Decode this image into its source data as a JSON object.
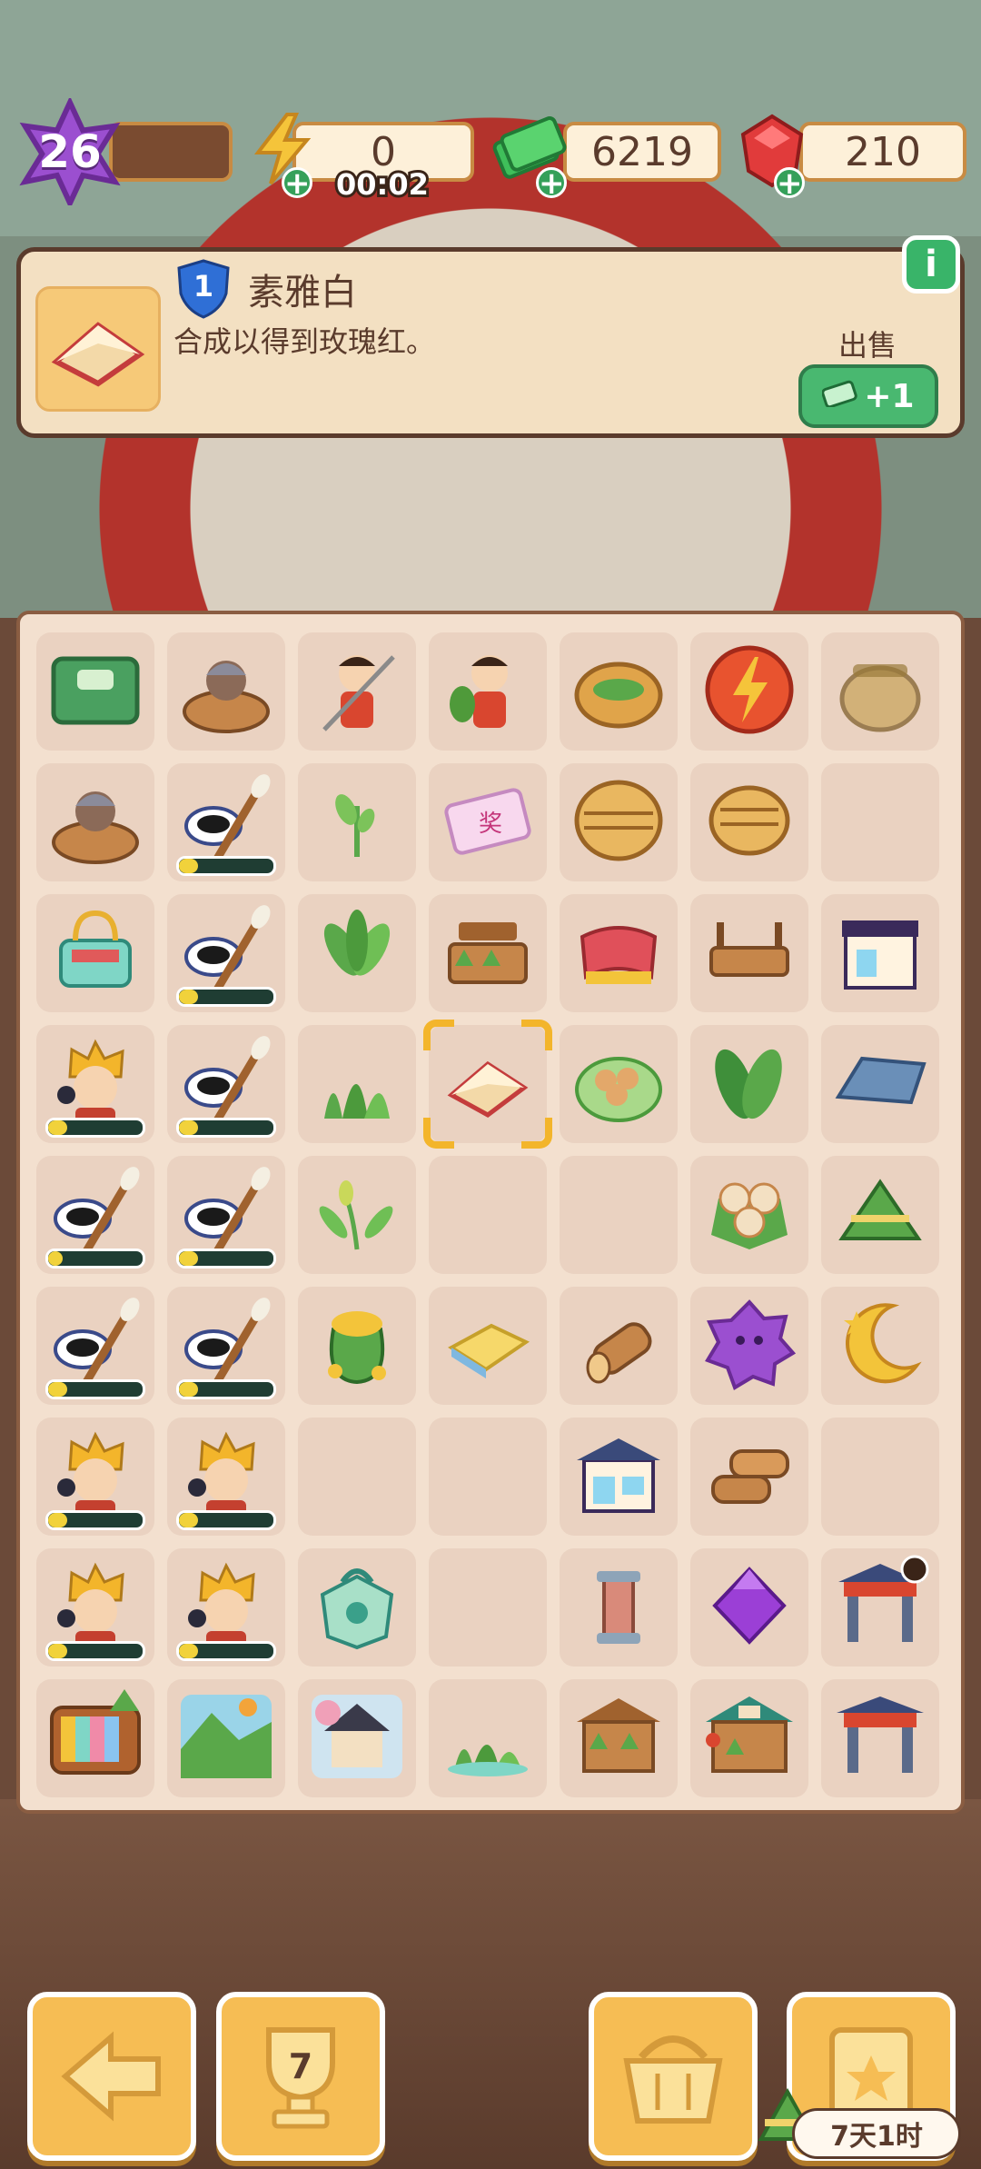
{
  "top_bar": {
    "level": "26",
    "energy": "0",
    "energy_timer": "00:02",
    "cash": "6219",
    "gems": "210"
  },
  "info_panel": {
    "tier": "1",
    "title": "素雅白",
    "description": "合成以得到玫瑰红。",
    "sell_label": "出售",
    "sell_value": "+1",
    "info_icon": "i"
  },
  "board": {
    "columns": 7,
    "rows": 9,
    "selected_cell": {
      "row": 3,
      "col": 3
    },
    "cells": [
      [
        "crate-icon",
        "bath-old-icon",
        "warrior-icon",
        "farmer-icon",
        "leaf-basket-icon",
        "energy-orb-icon",
        "pot-icon"
      ],
      [
        "bath-old-icon",
        "ink-brush-icon",
        "sprout-icon",
        "ticket-icon",
        "steamer-icon",
        "steamer-lid-icon",
        "empty"
      ],
      [
        "gift-basket-icon",
        "ink-brush-icon",
        "plant-icon",
        "zongzi-stall-icon",
        "cloth-icon",
        "table-icon",
        "shop-icon"
      ],
      [
        "chef-icon",
        "ink-brush-icon",
        "grass-icon",
        "tofu-icon",
        "dumpling-plate-icon",
        "big-leaves-icon",
        "roof-icon"
      ],
      [
        "ink-brush-icon",
        "ink-brush-icon",
        "rice-plant-icon",
        "empty",
        "empty",
        "dumpling-pile-icon",
        "zongzi-icon"
      ],
      [
        "ink-brush-icon",
        "ink-brush-icon",
        "money-bag-icon",
        "butter-icon",
        "log-icon",
        "purple-gem-icon",
        "moon-icon"
      ],
      [
        "chef-icon",
        "chef-icon",
        "empty",
        "empty",
        "shop-blue-icon",
        "logs-icon",
        "empty"
      ],
      [
        "chef-icon",
        "chef-icon",
        "jade-bag-icon",
        "empty",
        "pillar-icon",
        "purple-crystal-icon",
        "gate-icon"
      ],
      [
        "tv-icon",
        "landscape-icon",
        "village-icon",
        "small-grass-icon",
        "market-stall-icon",
        "zongzi-shop-icon",
        "archway-icon"
      ]
    ],
    "progress": {
      "1-1": 0.2,
      "2-1": 0.2,
      "3-0": 0.2,
      "3-1": 0.2,
      "4-0": 0.15,
      "4-1": 0.2,
      "5-0": 0.2,
      "5-1": 0.2,
      "6-0": 0.2,
      "6-1": 0.2,
      "7-0": 0.2,
      "7-1": 0.2
    }
  },
  "bottom_bar": {
    "trophy_count": "7",
    "task_timer": "7天1时"
  },
  "colors": {
    "accent_green": "#39b469",
    "panel_bg": "#f3e0c2",
    "board_bg": "#f3e0cf",
    "button_yellow": "#f6bd54"
  }
}
